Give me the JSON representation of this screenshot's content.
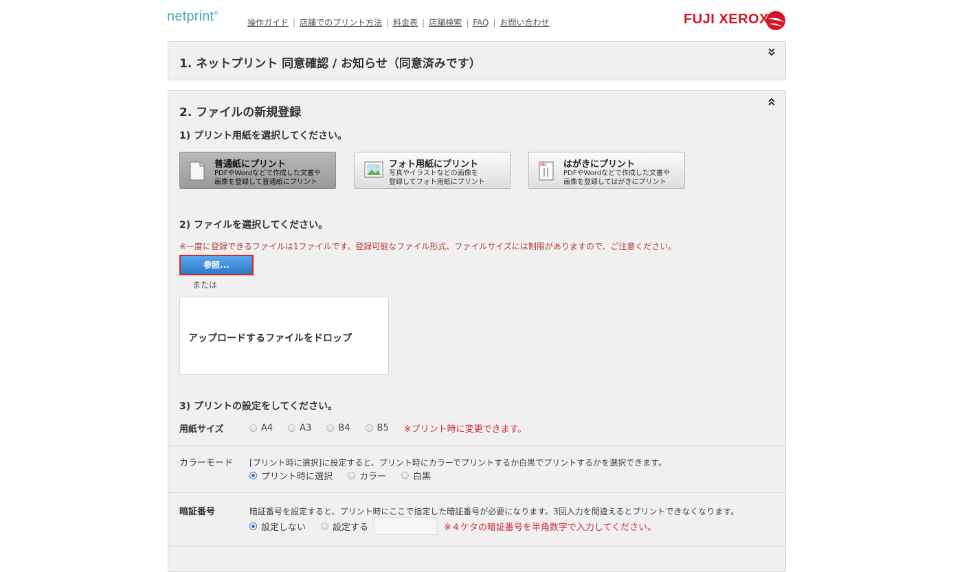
{
  "header": {
    "logo": "netprint",
    "logo_mark": "®",
    "nav": [
      "操作ガイド",
      "店舗でのプリント方法",
      "料金表",
      "店舗検索",
      "FAQ",
      "お問い合わせ"
    ],
    "brand": "FUJI XEROX",
    "brand_color": "#d7152a"
  },
  "section1": {
    "title": "1. ネットプリント 同意確認 / お知らせ（同意済みです）",
    "chevron": "chevron-double-down-icon"
  },
  "section2": {
    "title": "2. ファイルの新規登録",
    "chevron": "chevron-double-up-icon",
    "step1": "1) プリント用紙を選択してください。",
    "paper_options": [
      {
        "title": "普通紙にプリント",
        "line1": "PDFやWordなどで作成した文書や",
        "line2": "画像を登録して普通紙にプリント",
        "icon": "document-icon",
        "selected": true
      },
      {
        "title": "フォト用紙にプリント",
        "line1": "写真やイラストなどの画像を",
        "line2": "登録してフォト用紙にプリント",
        "icon": "photo-icon",
        "selected": false
      },
      {
        "title": "はがきにプリント",
        "line1": "PDFやWordなどで作成した文書や",
        "line2": "画像を登録してはがきにプリント",
        "icon": "postcard-icon",
        "selected": false
      }
    ],
    "step2": "2) ファイルを選択してください。",
    "notice": "※一度に登録できるファイルは1ファイルです。登録可能なファイル形式、ファイルサイズには制限がありますので、ご注意ください。",
    "browse_label": "参照...",
    "or_label": "または",
    "dropzone_label": "アップロードするファイルをドロップ",
    "step3": "3) プリントの設定をしてください。",
    "paper_size": {
      "label": "用紙サイズ",
      "options": [
        "A4",
        "A3",
        "B4",
        "B5"
      ],
      "note": "※プリント時に変更できます。"
    },
    "color_mode": {
      "label": "カラーモード",
      "description": "[プリント時に選択]に設定すると、プリント時にカラーでプリントするか白黒でプリントするかを選択できます。",
      "options": [
        "プリント時に選択",
        "カラー",
        "白黒"
      ],
      "selected": "プリント時に選択"
    },
    "pin": {
      "label": "暗証番号",
      "description": "暗証番号を設定すると、プリント時にここで指定した暗証番号が必要になります。3回入力を間違えるとプリントできなくなります。",
      "options": [
        "設定しない",
        "設定する"
      ],
      "selected": "設定しない",
      "input_value": "",
      "note": "※４ケタの暗証番号を半角数字で入力してください。"
    }
  }
}
